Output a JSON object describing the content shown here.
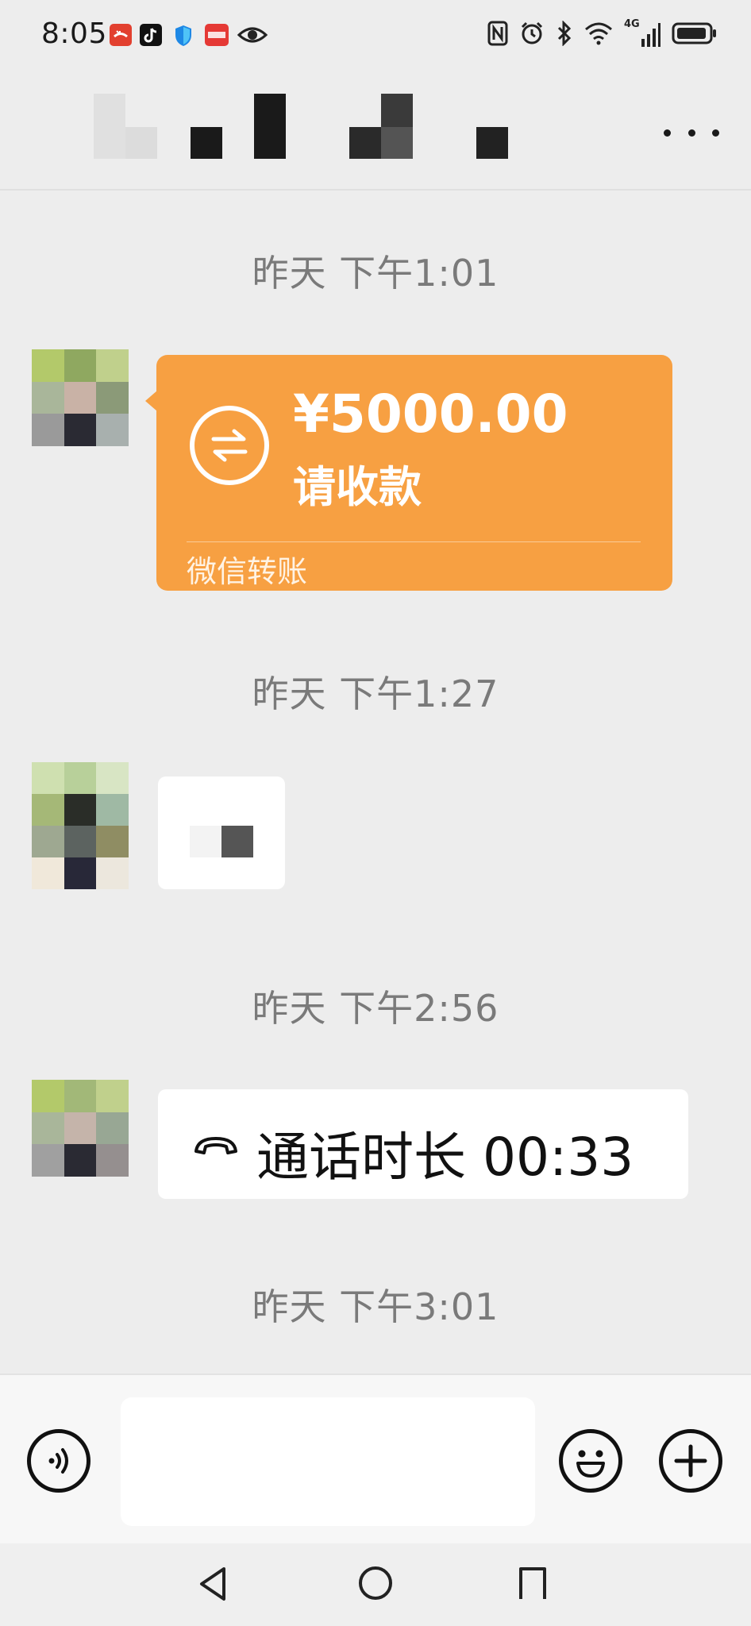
{
  "status_bar": {
    "time": "8:05",
    "notification_icons": [
      "missed-call-icon",
      "tiktok-icon",
      "shield-icon",
      "toutiao-icon",
      "eye-icon"
    ],
    "system_icons": [
      "nfc-icon",
      "alarm-icon",
      "bluetooth-icon",
      "wifi-icon",
      "signal-icon",
      "battery-icon"
    ],
    "network": "4G"
  },
  "header": {
    "contact_name": "",
    "more_icon": "more-dots-icon"
  },
  "messages": [
    {
      "type": "timestamp",
      "text": "昨天 下午1:01"
    },
    {
      "type": "transfer",
      "amount": "¥5000.00",
      "status": "请收款",
      "source": "微信转账",
      "icon": "transfer-arrows-icon"
    },
    {
      "type": "timestamp",
      "text": "昨天 下午1:27"
    },
    {
      "type": "pixelated-content"
    },
    {
      "type": "timestamp",
      "text": "昨天 下午2:56"
    },
    {
      "type": "call",
      "text": "通话时长 00:33",
      "icon": "phone-hangup-icon"
    },
    {
      "type": "timestamp",
      "text": "昨天 下午3:01"
    }
  ],
  "input_bar": {
    "voice_icon": "voice-icon",
    "input_value": "",
    "emoji_icon": "emoji-icon",
    "plus_icon": "plus-icon"
  },
  "nav_bar": {
    "icons": [
      "back-icon",
      "home-icon",
      "recents-icon"
    ]
  },
  "colors": {
    "background": "#ededed",
    "transfer_orange": "#f7a042",
    "bubble_white": "#ffffff",
    "timestamp_gray": "#7a7a7a"
  }
}
